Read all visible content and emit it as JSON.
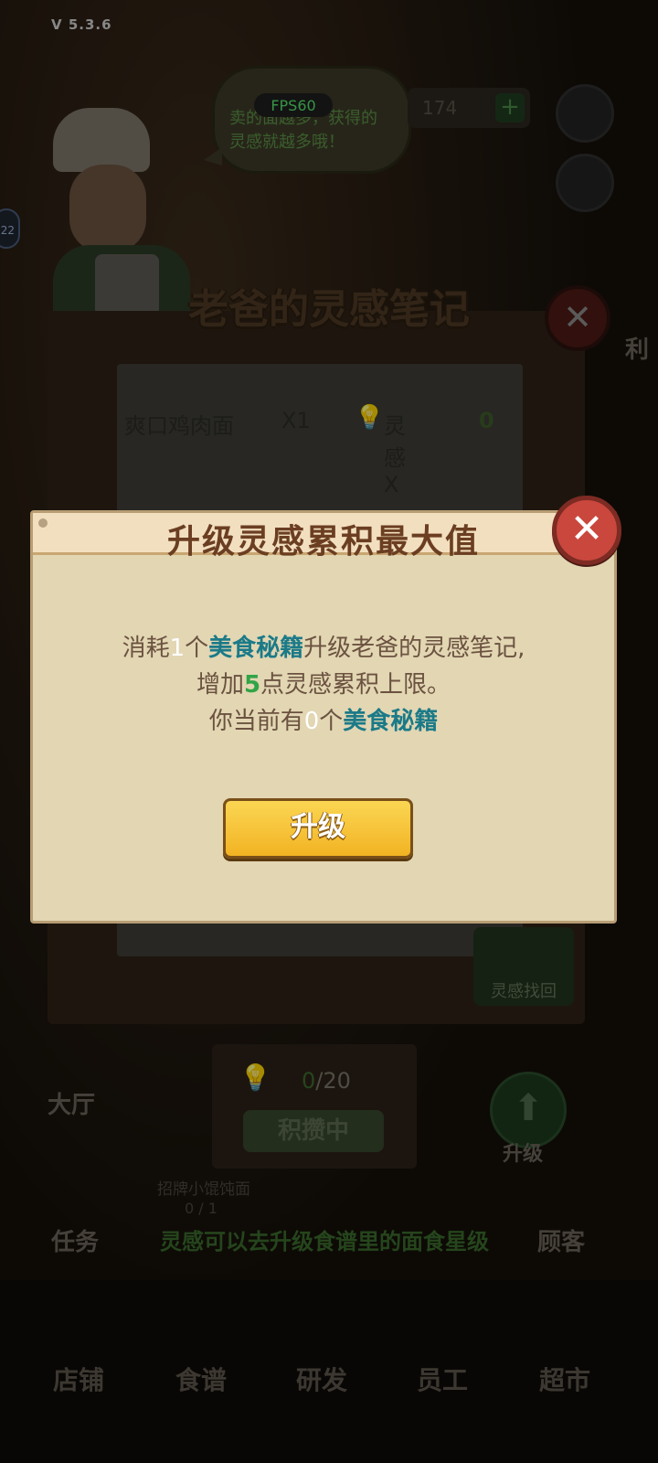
{
  "status": {
    "version": "V 5.3.6",
    "fps": "FPS60"
  },
  "background": {
    "speech_bubble": "卖的面越多，获得的灵感就越多哦！",
    "coin_count": "174",
    "side_badge": "22",
    "notebook": {
      "title": "老爸的灵感笔记",
      "recipe_name": "爽口鸡肉面",
      "recipe_qty": "X1",
      "inspiration_label": "灵感 X",
      "inspiration_value": "0",
      "recover_label": "灵感找回"
    },
    "progress": {
      "current": "0",
      "total": "/20",
      "button": "积攒中"
    },
    "dish_label": "招牌小馄饨面",
    "dish_progress": "0 / 1",
    "hint": "灵感可以去升级食谱里的面食星级",
    "side_labels": {
      "hall": "大厅",
      "task": "任务",
      "upgrade": "升级",
      "customer": "顾客",
      "misc": "利"
    },
    "tabs": [
      "店铺",
      "食谱",
      "研发",
      "员工",
      "超市"
    ]
  },
  "dialog": {
    "title": "升级灵感累积最大值",
    "close_symbol": "✕",
    "line1": {
      "prefix": "消耗",
      "count": "1",
      "mid": "个",
      "item": "美食秘籍",
      "suffix": "升级老爸的灵感笔记,"
    },
    "line2": {
      "prefix": "增加",
      "amount": "5",
      "suffix": "点灵感累积上限。"
    },
    "line3": {
      "prefix": "你当前有",
      "count": "0",
      "mid": "个",
      "item": "美食秘籍"
    },
    "upgrade_button": "升级"
  },
  "colors": {
    "dialog_bg": "#e2d6b3",
    "title_color": "#6b3e22",
    "highlight_teal": "#1b7a88",
    "highlight_green": "#32a447",
    "button_yellow": "#f8c63b",
    "close_red": "#c9473d"
  },
  "icons": {
    "bulb": "lightbulb-icon",
    "close": "close-icon",
    "arrow_up": "arrow-up-icon"
  }
}
